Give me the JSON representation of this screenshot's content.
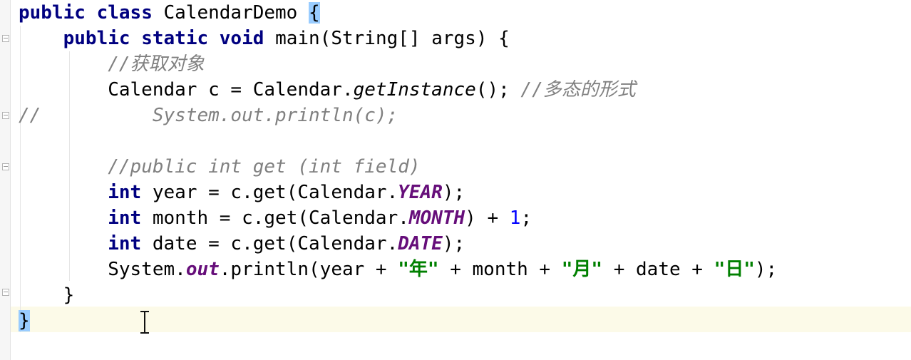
{
  "editor": {
    "lines": [
      {
        "tokens": [
          {
            "t": "public ",
            "c": "kw"
          },
          {
            "t": "class ",
            "c": "kw"
          },
          {
            "t": "CalendarDemo ",
            "c": "plain"
          },
          {
            "t": "{",
            "c": "brace-match"
          }
        ]
      },
      {
        "tokens": [
          {
            "t": "    ",
            "c": "plain"
          },
          {
            "t": "public ",
            "c": "kw"
          },
          {
            "t": "static ",
            "c": "kw"
          },
          {
            "t": "void ",
            "c": "kw"
          },
          {
            "t": "main(String[] args) {",
            "c": "plain"
          }
        ]
      },
      {
        "tokens": [
          {
            "t": "        ",
            "c": "plain"
          },
          {
            "t": "//获取对象",
            "c": "comment"
          }
        ]
      },
      {
        "tokens": [
          {
            "t": "        Calendar c = Calendar.",
            "c": "plain"
          },
          {
            "t": "getInstance",
            "c": "static-call"
          },
          {
            "t": "(); ",
            "c": "plain"
          },
          {
            "t": "//多态的形式",
            "c": "comment"
          }
        ]
      },
      {
        "tokens": [
          {
            "t": "//",
            "c": "comment"
          },
          {
            "t": "          ",
            "c": "plain"
          },
          {
            "t": "System.out.println(c);",
            "c": "comment"
          }
        ]
      },
      {
        "tokens": []
      },
      {
        "tokens": [
          {
            "t": "        ",
            "c": "plain"
          },
          {
            "t": "//public int get (int field)",
            "c": "comment"
          }
        ]
      },
      {
        "tokens": [
          {
            "t": "        ",
            "c": "plain"
          },
          {
            "t": "int ",
            "c": "kw"
          },
          {
            "t": "year = c.get(Calendar.",
            "c": "plain"
          },
          {
            "t": "YEAR",
            "c": "const"
          },
          {
            "t": ");",
            "c": "plain"
          }
        ]
      },
      {
        "tokens": [
          {
            "t": "        ",
            "c": "plain"
          },
          {
            "t": "int ",
            "c": "kw"
          },
          {
            "t": "month = c.get(Calendar.",
            "c": "plain"
          },
          {
            "t": "MONTH",
            "c": "const"
          },
          {
            "t": ") + ",
            "c": "plain"
          },
          {
            "t": "1",
            "c": "num"
          },
          {
            "t": ";",
            "c": "plain"
          }
        ]
      },
      {
        "tokens": [
          {
            "t": "        ",
            "c": "plain"
          },
          {
            "t": "int ",
            "c": "kw"
          },
          {
            "t": "date = c.get(Calendar.",
            "c": "plain"
          },
          {
            "t": "DATE",
            "c": "const"
          },
          {
            "t": ");",
            "c": "plain"
          }
        ]
      },
      {
        "tokens": [
          {
            "t": "        System.",
            "c": "plain"
          },
          {
            "t": "out",
            "c": "const"
          },
          {
            "t": ".println(year + ",
            "c": "plain"
          },
          {
            "t": "\"年\"",
            "c": "str"
          },
          {
            "t": " + month + ",
            "c": "plain"
          },
          {
            "t": "\"月\"",
            "c": "str"
          },
          {
            "t": " + date + ",
            "c": "plain"
          },
          {
            "t": "\"日\"",
            "c": "str"
          },
          {
            "t": ");",
            "c": "plain"
          }
        ]
      },
      {
        "tokens": [
          {
            "t": "    }",
            "c": "plain"
          }
        ]
      },
      {
        "tokens": [
          {
            "t": "}",
            "c": "brace-match"
          }
        ]
      }
    ],
    "colors": {
      "keyword": "#000080",
      "comment": "#808080",
      "constant": "#660e7a",
      "number": "#0000ff",
      "string": "#008000",
      "brace_match": "#99ccff",
      "current_line": "#fcfae8"
    }
  }
}
